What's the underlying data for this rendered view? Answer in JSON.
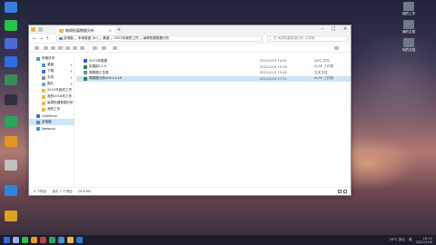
{
  "desktop_left": [
    {
      "label": "",
      "color": "#3a7be0"
    },
    {
      "label": "",
      "color": "#28c445"
    },
    {
      "label": "",
      "color": "#4a6bd8"
    },
    {
      "label": "",
      "color": "#2d6fe0"
    },
    {
      "label": "",
      "color": "#3a8c52"
    },
    {
      "label": "",
      "color": "#303040"
    },
    {
      "label": "",
      "color": "#2aa55a"
    },
    {
      "label": "",
      "color": "#e09620"
    },
    {
      "label": "",
      "color": "#c0c0c0"
    },
    {
      "label": "",
      "color": "#2a88e0"
    },
    {
      "label": "",
      "color": "#e0a020"
    }
  ],
  "desktop_right": [
    {
      "label": "我的工作"
    },
    {
      "label": "我的文档"
    },
    {
      "label": "你的文档"
    }
  ],
  "window": {
    "tab_title": "每周拓展数据分析",
    "address_segments": [
      "此电脑",
      ">",
      "本地磁盘 (D:)",
      ">",
      "桌面",
      ">",
      "2021年我的工作",
      ">",
      "每周拓展数据分析"
    ],
    "search_placeholder": "在 每周拓展数据分析 中搜索"
  },
  "sidebar": [
    {
      "label": "快速访问",
      "color": "#4a90d9",
      "pin": ""
    },
    {
      "label": "桌面",
      "color": "#4a90d9",
      "pin": "✦"
    },
    {
      "label": "下载",
      "color": "#2e7bd6",
      "pin": "✦"
    },
    {
      "label": "文档",
      "color": "#8a8a8a",
      "pin": "✦"
    },
    {
      "label": "图片",
      "color": "#4ab4e0",
      "pin": "✦"
    },
    {
      "label": "2021年我的工作",
      "color": "#e8b84a",
      "pin": ""
    },
    {
      "label": "我的2018年工作",
      "color": "#e8b84a",
      "pin": ""
    },
    {
      "label": "每周拓展数据分析",
      "color": "#e8b84a",
      "pin": ""
    },
    {
      "label": "我的工作",
      "color": "#e8b84a",
      "pin": ""
    },
    {
      "label": "OneDrive",
      "color": "#2e7bd6",
      "pin": ""
    },
    {
      "label": "此电脑",
      "color": "#4a90d9",
      "pin": "",
      "selected": true
    },
    {
      "label": "Network",
      "color": "#4a90d9",
      "pin": ""
    }
  ],
  "files": [
    {
      "name": "2021年数据",
      "date": "2021/2/23 14:42",
      "type": "DOC 文件",
      "color": "#2b5bd6"
    },
    {
      "name": "拓展部11.9",
      "date": "2021/11/9 15:59",
      "type": "XLSX 工作表",
      "color": "#1f8a4a"
    },
    {
      "name": "周数据汇总表",
      "date": "2021/11/3 13:45",
      "type": "文本文档",
      "color": "#888888"
    },
    {
      "name": "周数据分析2021.4.19",
      "date": "2021/4/19 17:11",
      "type": "XLSX 工作表",
      "color": "#1f8a4a",
      "selected": true
    }
  ],
  "status": {
    "count": "4 个项目",
    "selected": "选中 1 个项目",
    "size": "20.8 KB"
  },
  "taskbar": {
    "icons": [
      "#2d6fe0",
      "#8fb3ff",
      "#28c445",
      "#e0a020",
      "#c04040",
      "#2aa55a",
      "#4a90d9",
      "#e8b84a",
      "#2e7bd6"
    ],
    "weather": "24°C 多云",
    "ime": "英",
    "time": "10:12",
    "date": "2021/11/9"
  }
}
